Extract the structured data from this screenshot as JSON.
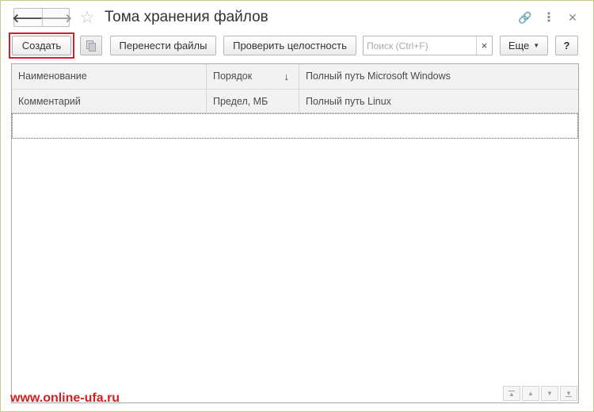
{
  "window": {
    "title": "Тома хранения файлов",
    "nav": {
      "back_icon": "arrow-left-icon",
      "back": "🡐",
      "forward_icon": "arrow-right-icon",
      "forward": "🡒"
    },
    "favorite_icon": "star-icon",
    "favorite_glyph": "☆",
    "link_glyph": "🔗",
    "menu_glyph": "⋮",
    "close_glyph": "✕"
  },
  "toolbar": {
    "create_label": "Создать",
    "copy_icon": "copy-icon",
    "move_files_label": "Перенести файлы",
    "check_integrity_label": "Проверить целостность",
    "search_placeholder": "Поиск (Ctrl+F)",
    "search_value": "",
    "search_clear_glyph": "×",
    "more_label": "Еще",
    "more_caret": "▼",
    "help_label": "?"
  },
  "table": {
    "header_row1": [
      "Наименование",
      "Порядок",
      "Полный путь Microsoft Windows"
    ],
    "header_row2": [
      "Комментарий",
      "Предел, МБ",
      "Полный путь Linux"
    ],
    "sort_indicator": "↓",
    "rows": []
  },
  "footer": {
    "nav_first": "▲",
    "nav_up": "▲",
    "nav_down": "▼",
    "nav_last": "▼"
  },
  "watermark": "www.online-ufa.ru",
  "colors": {
    "highlight_frame": "#d0202a",
    "watermark": "#d42020",
    "window_border": "#c9c98f"
  }
}
